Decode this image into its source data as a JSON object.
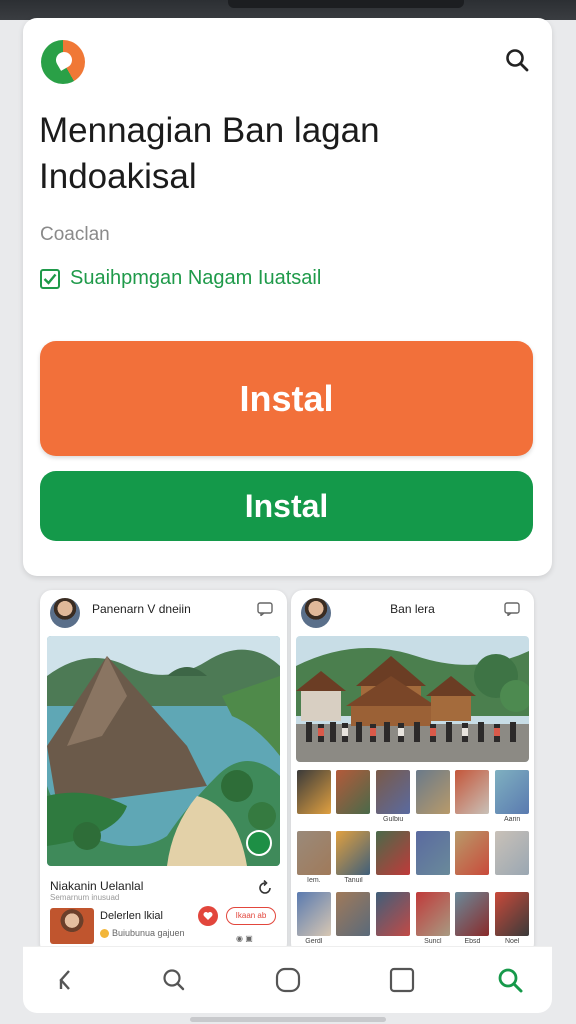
{
  "header": {
    "title": "Mennagian Ban lagan Indoakisal",
    "subtitle": "Coaclan",
    "checkbox_label": "Suaihpmgan Nagam Iuatsail"
  },
  "buttons": {
    "primary_label": "Instal",
    "secondary_label": "Instal"
  },
  "colors": {
    "primary_button": "#f2703a",
    "secondary_button": "#14994a",
    "accent_green": "#1f9a4a"
  },
  "cards": {
    "left": {
      "author": "Panenarn V dneiin",
      "caption_title": "Niakanin Uelanlal",
      "caption_sub": "Semarnum inusuad",
      "comment_name": "Delerlen lkial",
      "comment_text": "Buiubunua gajuen",
      "follow_label": "Ikaan ab"
    },
    "right": {
      "author": "Ban lera",
      "grid_labels": [
        "",
        "",
        "Gulbiu",
        "",
        "",
        "Aarin",
        "Iem.",
        "Tanuil",
        "",
        "",
        "",
        "",
        "Gerdl",
        "",
        "",
        "Suncl",
        "Ebsd",
        "Noel",
        "",
        "",
        "",
        "",
        "",
        ""
      ]
    }
  },
  "icons": {
    "search": "search-icon",
    "chat": "chat-icon",
    "refresh": "refresh-icon",
    "nav": [
      "back-icon",
      "search-outline-icon",
      "home-circle-icon",
      "recents-square-icon",
      "search-active-icon"
    ]
  }
}
